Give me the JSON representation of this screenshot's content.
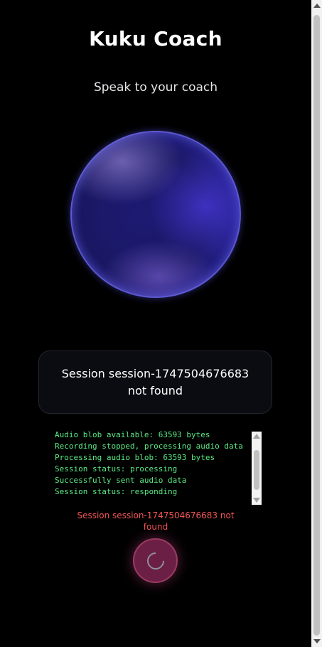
{
  "header": {
    "title": "Kuku Coach",
    "subtitle": "Speak to your coach"
  },
  "orb": {
    "icon": "voice-orb"
  },
  "status_card": {
    "message": "Session session-1747504676683 not found"
  },
  "log": {
    "lines": [
      "Audio blob available: 63593 bytes",
      "Recording stopped, processing audio data",
      "Processing audio blob: 63593 bytes",
      "Session status: processing",
      "Successfully sent audio data",
      "Session status: responding"
    ]
  },
  "error": {
    "message": "Session session-1747504676683 not found"
  },
  "mic_button": {
    "icon": "loading-spinner-icon",
    "state": "processing"
  },
  "colors": {
    "background": "#000000",
    "log_text": "#5bea84",
    "error_text": "#f25555",
    "mic_button": "#6b1f44",
    "orb": "#1d1a73"
  }
}
